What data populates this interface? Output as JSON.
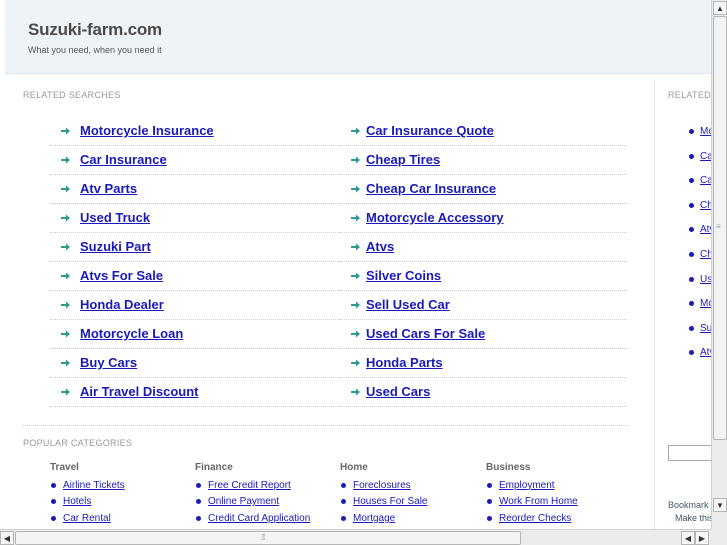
{
  "header": {
    "title": "Suzuki-farm.com",
    "tagline": "What you need, when you need it"
  },
  "related": {
    "heading": "RELATED SEARCHES",
    "col1": [
      "Motorcycle Insurance",
      "Car Insurance",
      "Atv Parts",
      "Used Truck",
      "Suzuki Part",
      "Atvs For Sale",
      "Honda Dealer",
      "Motorcycle Loan",
      "Buy Cars",
      "Air Travel Discount"
    ],
    "col2": [
      "Car Insurance Quote",
      "Cheap Tires",
      "Cheap Car Insurance",
      "Motorcycle Accessory",
      "Atvs",
      "Silver Coins",
      "Sell Used Car",
      "Used Cars For Sale",
      "Honda Parts",
      "Used Cars"
    ]
  },
  "popular": {
    "heading": "POPULAR CATEGORIES",
    "columns": [
      {
        "title": "Travel",
        "items": [
          "Airline Tickets",
          "Hotels",
          "Car Rental"
        ]
      },
      {
        "title": "Finance",
        "items": [
          "Free Credit Report",
          "Online Payment",
          "Credit Card Application"
        ]
      },
      {
        "title": "Home",
        "items": [
          "Foreclosures",
          "Houses For Sale",
          "Mortgage"
        ]
      },
      {
        "title": "Business",
        "items": [
          "Employment",
          "Work From Home",
          "Reorder Checks"
        ]
      }
    ]
  },
  "sidebar": {
    "heading": "RELATED",
    "items": [
      "Mc",
      "Ca",
      "Ca",
      "Ch",
      "Atv",
      "Ch",
      "Us",
      "Mc",
      "Su",
      "Atv"
    ],
    "bookmark": "Bookmark",
    "make_this": "Make this"
  },
  "colors": {
    "link": "#1a1ab8",
    "arrow": "#2e9a8a",
    "header_bg": "#eef3f7"
  },
  "icons": {
    "arrow": "right-arrow-icon",
    "bullet": "bullet-dot-icon"
  }
}
